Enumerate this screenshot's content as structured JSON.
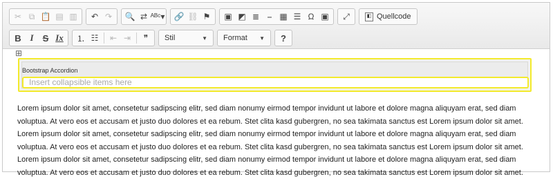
{
  "toolbar": {
    "row1": {
      "clipboard": [
        {
          "name": "cut-icon",
          "glyph": "✂",
          "disabled": true
        },
        {
          "name": "copy-icon",
          "glyph": "⧉",
          "disabled": true
        },
        {
          "name": "paste-icon",
          "glyph": "📋",
          "disabled": true
        },
        {
          "name": "paste-text-icon",
          "glyph": "▤",
          "disabled": true
        },
        {
          "name": "paste-word-icon",
          "glyph": "▥",
          "disabled": true
        }
      ],
      "undo_redo": [
        {
          "name": "undo-icon",
          "glyph": "↶",
          "disabled": false
        },
        {
          "name": "redo-icon",
          "glyph": "↷",
          "disabled": true
        }
      ],
      "find": [
        {
          "name": "find-icon",
          "glyph": "🔍",
          "disabled": false
        },
        {
          "name": "replace-icon",
          "glyph": "⇄",
          "disabled": false
        },
        {
          "name": "spellcheck-icon",
          "glyph": "ᴬᴮᶜ▾",
          "disabled": false
        }
      ],
      "links": [
        {
          "name": "link-icon",
          "glyph": "🔗",
          "disabled": false
        },
        {
          "name": "unlink-icon",
          "glyph": "⛓",
          "disabled": true
        },
        {
          "name": "anchor-flag-icon",
          "glyph": "⚑",
          "disabled": false
        }
      ],
      "insert": [
        {
          "name": "image-icon",
          "glyph": "▣",
          "disabled": false
        },
        {
          "name": "image2-icon",
          "glyph": "◩",
          "disabled": false
        },
        {
          "name": "bulleted-block-icon",
          "glyph": "≣",
          "disabled": false
        },
        {
          "name": "horizontal-rule-icon",
          "glyph": "⎯",
          "disabled": false
        },
        {
          "name": "table-icon",
          "glyph": "▦",
          "disabled": false
        },
        {
          "name": "justify-icon",
          "glyph": "☰",
          "disabled": false
        },
        {
          "name": "special-char-icon",
          "glyph": "Ω",
          "disabled": false
        },
        {
          "name": "media-icon",
          "glyph": "▣",
          "disabled": false
        }
      ],
      "maximize": {
        "name": "maximize-icon",
        "glyph": "⤢"
      },
      "source_label": "Quellcode"
    },
    "row2": {
      "basic": [
        {
          "name": "bold-icon",
          "glyph": "B",
          "cls": "bold"
        },
        {
          "name": "italic-icon",
          "glyph": "I",
          "cls": "italic"
        },
        {
          "name": "strike-icon",
          "glyph": "S",
          "cls": "strike"
        },
        {
          "name": "remove-format-icon",
          "glyph": "Ix",
          "cls": "clearfmt"
        }
      ],
      "lists": [
        {
          "name": "numbered-list-icon",
          "glyph": "⒈",
          "disabled": false
        },
        {
          "name": "bulleted-list-icon",
          "glyph": "☷",
          "disabled": false
        }
      ],
      "indent": [
        {
          "name": "outdent-icon",
          "glyph": "⇤",
          "disabled": true
        },
        {
          "name": "indent-icon",
          "glyph": "⇥",
          "disabled": true
        },
        {
          "name": "blockquote-icon",
          "glyph": "❞",
          "disabled": false
        }
      ],
      "style_label": "Stil",
      "format_label": "Format",
      "help_label": "?"
    }
  },
  "widget": {
    "title": "Bootstrap Accordion",
    "input_placeholder": "Insert collapsible items here"
  },
  "body_text": "Lorem ipsum dolor sit amet, consetetur sadipscing elitr, sed diam nonumy eirmod tempor invidunt ut labore et dolore magna aliquyam erat, sed diam voluptua. At vero eos et accusam et justo duo dolores et ea rebum. Stet clita kasd gubergren, no sea takimata sanctus est Lorem ipsum dolor sit amet. Lorem ipsum dolor sit amet, consetetur sadipscing elitr, sed diam nonumy eirmod tempor invidunt ut labore et dolore magna aliquyam erat, sed diam voluptua. At vero eos et accusam et justo duo dolores et ea rebum. Stet clita kasd gubergren, no sea takimata sanctus est Lorem ipsum dolor sit amet. Lorem ipsum dolor sit amet, consetetur sadipscing elitr, sed diam nonumy eirmod tempor invidunt ut labore et dolore magna aliquyam erat, sed diam voluptua. At vero eos et accusam et justo duo dolores et ea rebum. Stet clita kasd gubergren, no sea takimata sanctus est Lorem ipsum dolor sit amet."
}
